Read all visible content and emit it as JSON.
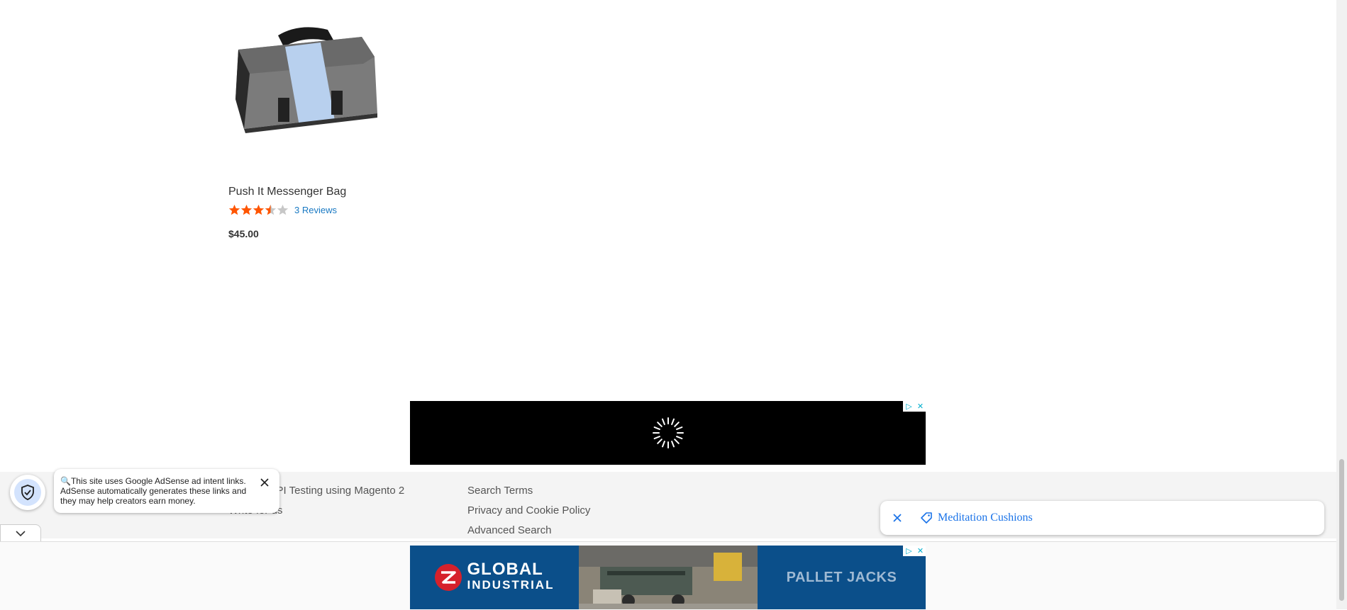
{
  "product": {
    "name": "Push It Messenger Bag",
    "rating_stars": 3.5,
    "reviews_label": "3 Reviews",
    "price": "$45.00"
  },
  "footer": {
    "col1": [
      "Practice API Testing using Magento 2",
      "Write for us"
    ],
    "col2": [
      "Search Terms",
      "Privacy and Cookie Policy",
      "Advanced Search"
    ]
  },
  "adsense_notice": {
    "text": "This site uses Google AdSense ad intent links. AdSense automatically generates these links and they may help creators earn money."
  },
  "intent_chip": {
    "label": "Meditation Cushions"
  },
  "bottom_ad": {
    "brand_line1": "GLOBAL",
    "brand_line2": "INDUSTRIAL",
    "headline": "PALLET JACKS"
  },
  "colors": {
    "link": "#1979c3",
    "star_on": "#ff5501",
    "star_off": "#c7c7c7",
    "chip_text": "#1a73e8",
    "ad_brand_red": "#d6212b",
    "ad_blue": "#0b4f8a"
  }
}
